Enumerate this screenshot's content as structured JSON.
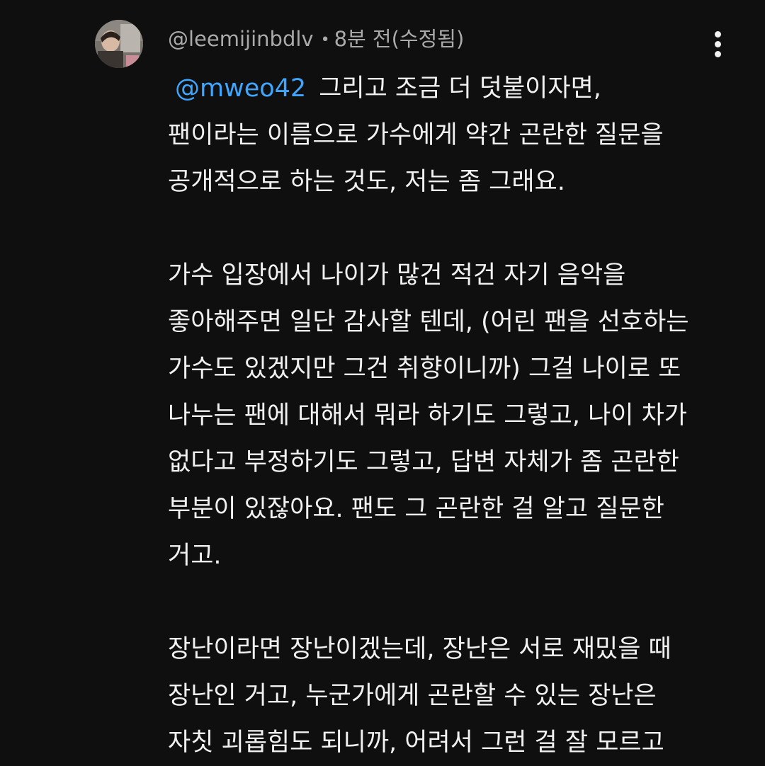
{
  "comment": {
    "author": "@leemijinbdlv",
    "separator": "•",
    "timestamp": "8분 전(수정됨)",
    "mention": "@mweo42",
    "paragraphs": [
      {
        "lines": [
          "그리고 조금 더 덧붙이자면,",
          "팬이라는 이름으로 가수에게 약간 곤란한 질문을",
          "공개적으로 하는 것도, 저는 좀  그래요."
        ]
      },
      {
        "lines": [
          "가수 입장에서 나이가 많건 적건 자기 음악을",
          "좋아해주면 일단 감사할 텐데, (어린 팬을 선호하는",
          "가수도 있겠지만 그건 취향이니까) 그걸 나이로 또",
          "나누는 팬에 대해서 뭐라 하기도 그렇고, 나이 차가",
          "없다고 부정하기도 그렇고, 답변 자체가 좀 곤란한",
          "부분이 있잖아요. 팬도 그 곤란한 걸 알고 질문한",
          "거고."
        ]
      },
      {
        "lines": [
          "장난이라면 장난이겠는데, 장난은 서로 재밌을 때",
          "장난인 거고, 누군가에게 곤란할 수 있는 장난은",
          "자칫 괴롭힘도 되니까, 어려서 그런 걸 잘 모르고"
        ]
      }
    ]
  },
  "icons": {
    "avatar": "avatar",
    "more": "more-vert-icon"
  },
  "colors": {
    "background": "#0f0f0f",
    "text": "#f1f1f1",
    "meta": "#aaaaaa",
    "mention": "#3ea6ff"
  }
}
